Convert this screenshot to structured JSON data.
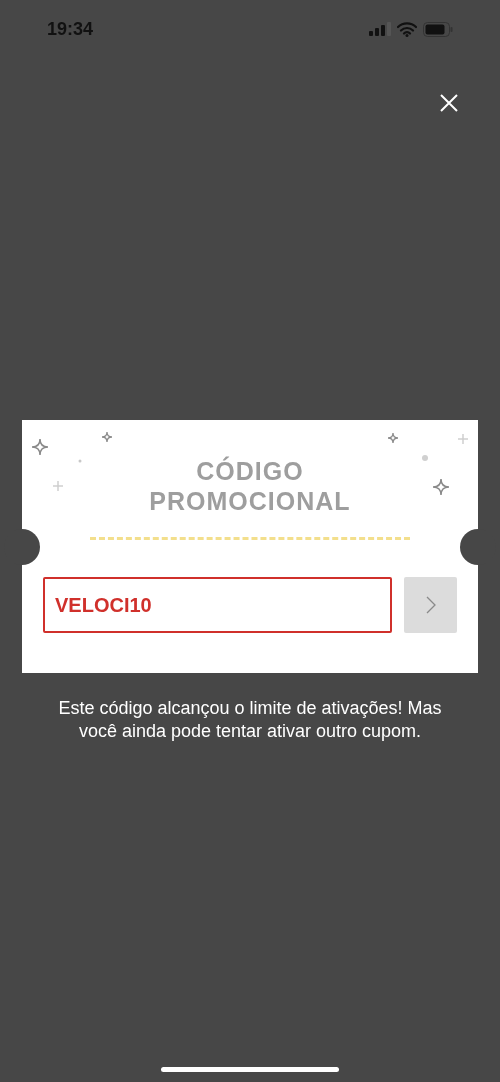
{
  "status_bar": {
    "time": "19:34"
  },
  "coupon": {
    "title_lines": [
      "CÓDIGO",
      "PROMOCIONAL"
    ],
    "code": "VELOCI10",
    "error": true,
    "submit_disabled": true
  },
  "message": "Este código alcançou o limite de ativações! Mas você ainda pode tentar ativar outro cupom."
}
